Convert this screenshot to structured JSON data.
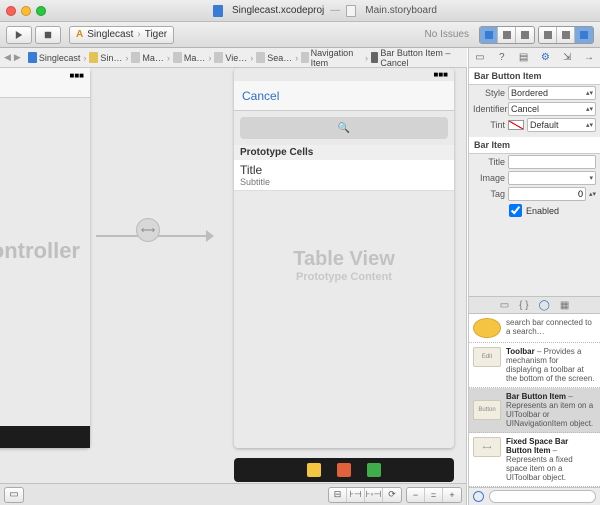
{
  "window": {
    "project": "Singlecast.xcodeproj",
    "file": "Main.storyboard",
    "scheme": "Singlecast",
    "destination": "Tiger",
    "noIssues": "No Issues"
  },
  "jumpbar": [
    "Singlecast",
    "Sin…",
    "Ma…",
    "Ma…",
    "Vie…",
    "Sea…",
    "Navigation Item",
    "Bar Button Item – Cancel"
  ],
  "scene_left": {
    "title": "Controller",
    "suffix": "n Controller"
  },
  "scene_right": {
    "cancel": "Cancel",
    "searchPlaceholder": "",
    "prototypeHeader": "Prototype Cells",
    "cellTitle": "Title",
    "cellSubtitle": "Subtitle",
    "tableView": "Table View",
    "prototypeContent": "Prototype Content"
  },
  "inspector": {
    "section1": "Bar Button Item",
    "styleLabel": "Style",
    "style": "Bordered",
    "identifierLabel": "Identifier",
    "identifier": "Cancel",
    "tintLabel": "Tint",
    "tint": "Default",
    "section2": "Bar Item",
    "titleLabel": "Title",
    "titleVal": "",
    "imageLabel": "Image",
    "imageVal": "",
    "tagLabel": "Tag",
    "tagVal": "0",
    "enabled": "Enabled"
  },
  "library": {
    "item0": "search bar connected to a search…",
    "toolbar_t": "Toolbar",
    "toolbar_d": " – Provides a mechanism for displaying a toolbar at the bottom of the screen.",
    "bbi_t": "Bar Button Item",
    "bbi_d": " – Represents an item on a UIToolbar or UINavigationItem object.",
    "fs_t": "Fixed Space Bar Button Item",
    "fs_d": " – Represents a fixed space item on a UIToolbar object.",
    "thumbEdit": "Edit",
    "thumbButton": "Button"
  }
}
